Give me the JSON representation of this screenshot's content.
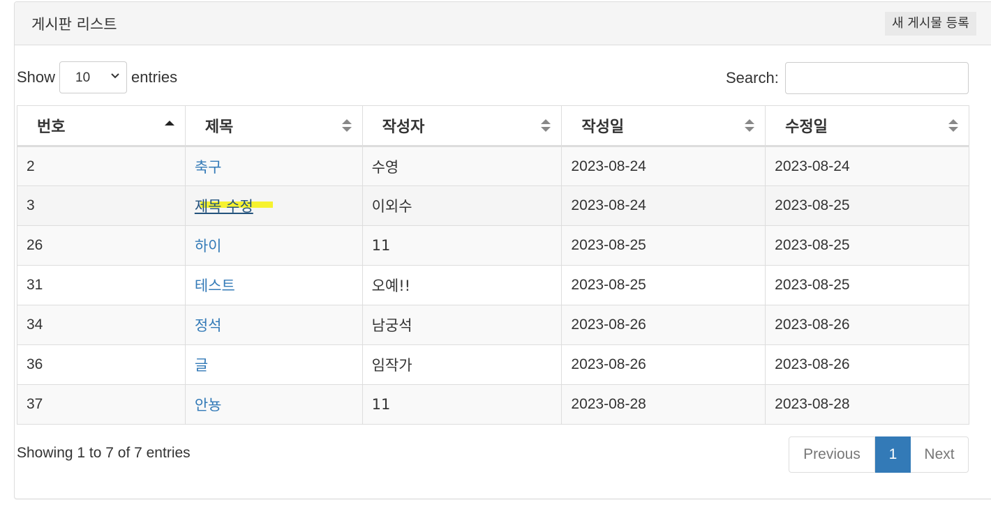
{
  "panel": {
    "title": "게시판 리스트",
    "new_post_label": "새 게시물 등록"
  },
  "length": {
    "prefix": "Show",
    "selected": "10",
    "suffix": "entries"
  },
  "search": {
    "label": "Search:",
    "value": "",
    "placeholder": ""
  },
  "table": {
    "columns": [
      "번호",
      "제목",
      "작성자",
      "작성일",
      "수정일"
    ],
    "sorted_column": "번호",
    "sort_direction": "asc",
    "rows": [
      {
        "no": "2",
        "title": "축구",
        "author": "수영",
        "created": "2023-08-24",
        "modified": "2023-08-24"
      },
      {
        "no": "3",
        "title": "제목 수정",
        "author": "이외수",
        "created": "2023-08-24",
        "modified": "2023-08-25"
      },
      {
        "no": "26",
        "title": "하이",
        "author": "11",
        "created": "2023-08-25",
        "modified": "2023-08-25"
      },
      {
        "no": "31",
        "title": "테스트",
        "author": "오예!!",
        "created": "2023-08-25",
        "modified": "2023-08-25"
      },
      {
        "no": "34",
        "title": "정석",
        "author": "남궁석",
        "created": "2023-08-26",
        "modified": "2023-08-26"
      },
      {
        "no": "36",
        "title": "글",
        "author": "임작가",
        "created": "2023-08-26",
        "modified": "2023-08-26"
      },
      {
        "no": "37",
        "title": "안뇽",
        "author": "11",
        "created": "2023-08-28",
        "modified": "2023-08-28"
      }
    ]
  },
  "info": "Showing 1 to 7 of 7 entries",
  "pagination": {
    "previous": "Previous",
    "current": "1",
    "next": "Next"
  },
  "colors": {
    "link": "#337ab7",
    "active_page": "#337ab7",
    "highlight": "#f6f21a",
    "border": "#dddddd"
  }
}
